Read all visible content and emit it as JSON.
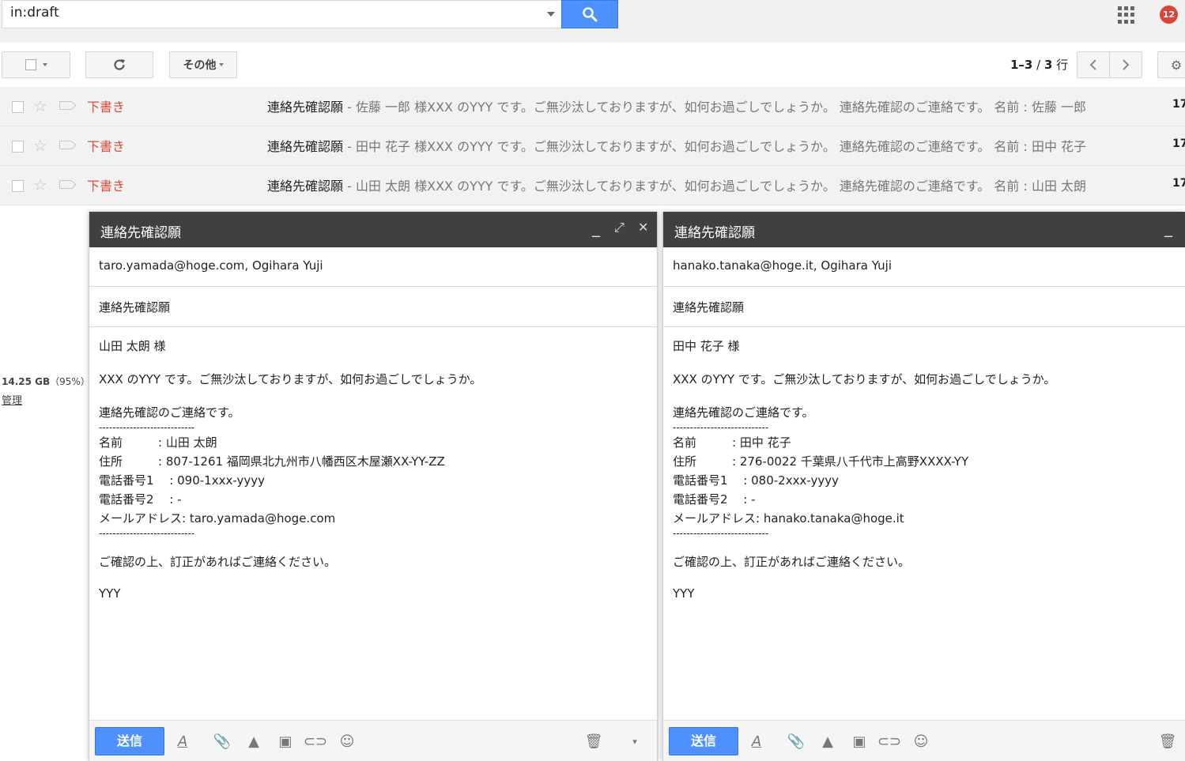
{
  "search": {
    "query": "in:draft"
  },
  "header": {
    "notification_count": "12"
  },
  "toolbar": {
    "more_label": "その他"
  },
  "pager": {
    "range": "1–3",
    "sep": " / ",
    "total": "3",
    "unit": " 行"
  },
  "rows": [
    {
      "sender": "下書き",
      "subject": "連絡先確認願",
      "snippet": " - 佐藤 一郎 様XXX のYYY です。ご無沙汰しておりますが、如何お過ごしでしょうか。 連絡先確認のご連絡です。 名前 : 佐藤 一郎",
      "date": "17"
    },
    {
      "sender": "下書き",
      "subject": "連絡先確認願",
      "snippet": " - 田中 花子 様XXX のYYY です。ご無沙汰しておりますが、如何お過ごしでしょうか。 連絡先確認のご連絡です。 名前 : 田中 花子",
      "date": "17"
    },
    {
      "sender": "下書き",
      "subject": "連絡先確認願",
      "snippet": " - 山田 太朗 様XXX のYYY です。ご無沙汰しておりますが、如何お過ごしでしょうか。 連絡先確認のご連絡です。 名前 : 山田 太朗",
      "date": "17"
    }
  ],
  "storage": {
    "used": "14.25 GB",
    "percent": "（95%）",
    "manage": "管理"
  },
  "compose": [
    {
      "title": "連絡先確認願",
      "to": "taro.yamada@hoge.com, Ogihara Yuji",
      "subject": "連絡先確認願",
      "body": {
        "greeting": "山田 太朗 様",
        "intro": "XXX のYYY です。ご無沙汰しておりますが、如何お過ごしでしょうか。",
        "purpose": "連絡先確認のご連絡です。",
        "divider": "----------------------------",
        "name": "名前　　　: 山田 太朗",
        "address": "住所　　　: 807-1261 福岡県北九州市八幡西区木屋瀬XX-YY-ZZ",
        "phone1": "電話番号1　 : 090-1xxx-yyyy",
        "phone2": "電話番号2　 : -",
        "email": "メールアドレス: taro.yamada@hoge.com",
        "closing": "ご確認の上、訂正があればご連絡ください。",
        "signature": "YYY"
      },
      "send_label": "送信"
    },
    {
      "title": "連絡先確認願",
      "to": "hanako.tanaka@hoge.it, Ogihara Yuji",
      "subject": "連絡先確認願",
      "body": {
        "greeting": "田中 花子 様",
        "intro": "XXX のYYY です。ご無沙汰しておりますが、如何お過ごしでしょうか。",
        "purpose": "連絡先確認のご連絡です。",
        "divider": "----------------------------",
        "name": "名前　　　: 田中 花子",
        "address": "住所　　　: 276-0022 千葉県八千代市上高野XXXX-YY",
        "phone1": "電話番号1　 : 080-2xxx-yyyy",
        "phone2": "電話番号2　 : -",
        "email": "メールアドレス: hanako.tanaka@hoge.it",
        "closing": "ご確認の上、訂正があればご連絡ください。",
        "signature": "YYY"
      },
      "send_label": "送信"
    }
  ]
}
